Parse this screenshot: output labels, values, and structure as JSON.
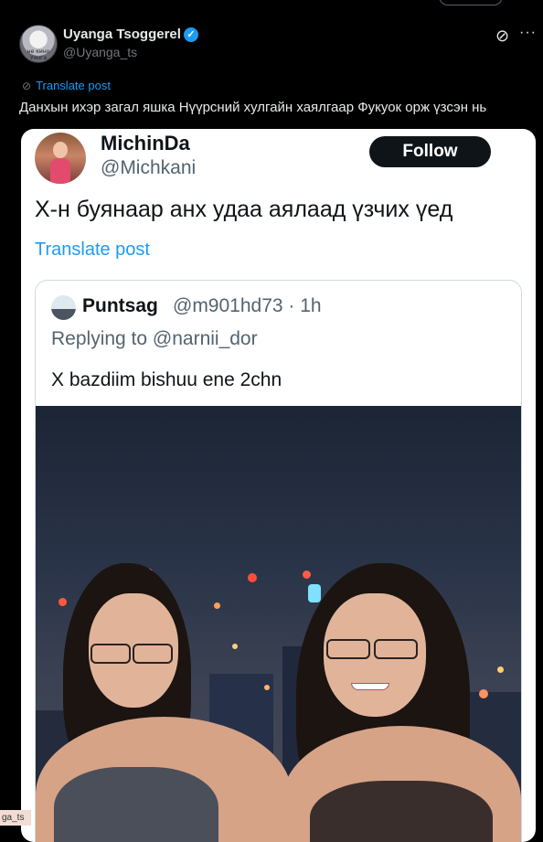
{
  "post": {
    "author_name": "Uyanga Tsoggerel",
    "handle": "@Uyanga_ts",
    "avatar_text": "не кино  Уянга",
    "translate_label": "Translate post",
    "text": "Данхын ихэр загал яшка Нүүрсний хулгайн хаялгаар Фукуок орж үзсэн нь"
  },
  "embedded": {
    "author_name": "MichinDa",
    "handle": "@Michkani",
    "follow_label": "Follow",
    "text": "Х-н буянаар анх удаа аялаад үзчих үед",
    "translate_label": "Translate post",
    "quote": {
      "author_name": "Puntsag",
      "handle_time": "@m901hd73 · 1h",
      "replying_to": "Replying to @narnii_dor",
      "text": "X bazdiim bishuu ene 2chn"
    }
  },
  "tooltip": {
    "text": "ga_ts"
  },
  "icons": {
    "verified": "verified-badge-icon",
    "translate": "translate-icon",
    "grok": "grok-icon",
    "more": "more-icon"
  },
  "colors": {
    "background": "#000000",
    "accent": "#1d9bf0",
    "follow_button": "#0f1419",
    "text_primary": "#e7e9ea",
    "text_secondary": "#71767b"
  }
}
